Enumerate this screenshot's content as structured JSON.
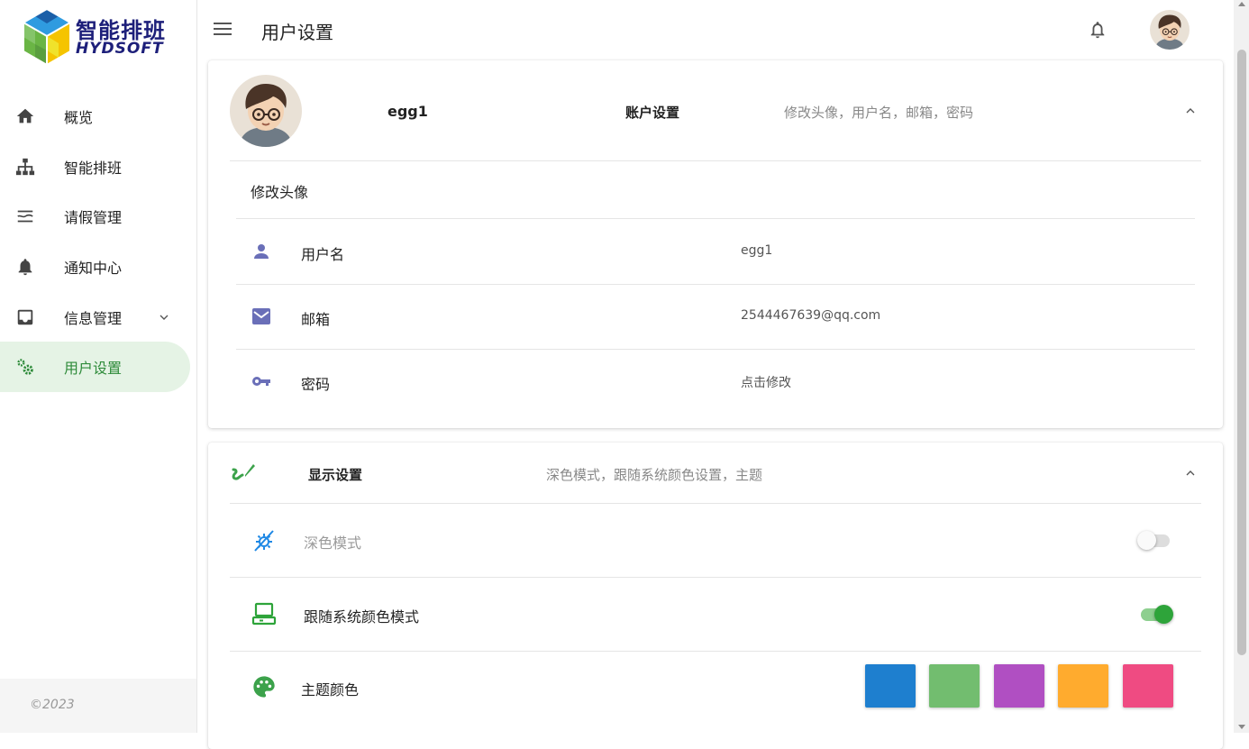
{
  "brand": {
    "title_cn": "智能排班",
    "title_en": "HYDSOFT"
  },
  "sidebar": {
    "items": [
      {
        "label": "概览",
        "icon": "home-icon"
      },
      {
        "label": "智能排班",
        "icon": "sitemap-icon"
      },
      {
        "label": "请假管理",
        "icon": "lines-icon"
      },
      {
        "label": "通知中心",
        "icon": "bell-icon"
      },
      {
        "label": "信息管理",
        "icon": "inbox-icon",
        "expandable": true
      },
      {
        "label": "用户设置",
        "icon": "cogs-icon",
        "active": true
      }
    ],
    "footer": "©2023"
  },
  "header": {
    "title": "用户设置"
  },
  "account": {
    "username_display": "egg1",
    "section_title": "账户设置",
    "section_desc": "修改头像，用户名，邮箱，密码",
    "change_avatar": "修改头像",
    "rows": [
      {
        "key": "用户名",
        "value": "egg1",
        "icon": "person-icon"
      },
      {
        "key": "邮箱",
        "value": "2544467639@qq.com",
        "icon": "mail-icon"
      },
      {
        "key": "密码",
        "value": "点击修改",
        "icon": "key-icon"
      }
    ]
  },
  "display": {
    "section_title": "显示设置",
    "section_desc": "深色模式，跟随系统颜色设置，主题",
    "dark_mode": {
      "label": "深色模式",
      "enabled": false
    },
    "follow_system": {
      "label": "跟随系统颜色模式",
      "enabled": true
    },
    "theme": {
      "label": "主题颜色",
      "colors": [
        "#1e7fcf",
        "#72bd6f",
        "#b04fc2",
        "#ffab2e",
        "#ef4b82"
      ]
    }
  },
  "colors": {
    "accent": "#2e8b3a",
    "active_bg": "#e5f3e5",
    "icon_purple": "#6a6fb8"
  }
}
